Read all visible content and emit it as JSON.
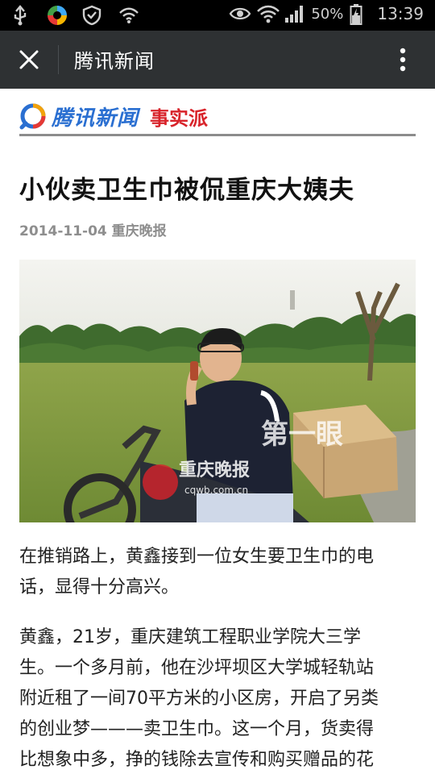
{
  "statusbar": {
    "battery_percent": "50%",
    "time": "13:39",
    "icons": [
      "usb-icon",
      "colorful-app-icon",
      "shield-icon",
      "wifi-hotspot-icon",
      "eye-icon",
      "wifi-icon",
      "signal-icon",
      "battery-icon"
    ]
  },
  "topbar": {
    "title": "腾讯新闻",
    "close_icon": "close-icon",
    "more_icon": "more-vertical-icon"
  },
  "article": {
    "brand_name": "腾讯新闻",
    "brand_column": "事实派",
    "headline": "小伙卖卫生巾被侃重庆大姨夫",
    "date": "2014-11-04",
    "source": "重庆晚报",
    "photo_watermark": "重庆晚报",
    "photo_watermark_url": "cqwb.com.cn",
    "photo_watermark_tag": "第一眼",
    "paragraphs": [
      [
        "在推销路上，黄鑫接到一位女生要卫生巾的电",
        "话，显得十分高兴。"
      ],
      [
        "黄鑫，21岁，重庆建筑工程职业学院大三学",
        "生。一个多月前，他在沙坪坝区大学城轻轨站",
        "附近租了一间70平方米的小区房，开启了另类",
        "的创业梦———卖卫生巾。这一个月，货卖得",
        "比想象中多，挣的钱除去宣传和购买赠品的花"
      ]
    ]
  },
  "colors": {
    "statusbar_bg": "#000000",
    "topbar_bg": "#2e3133",
    "brand_blue": "#2a6fd1",
    "brand_red": "#d8232a",
    "meta_gray": "#8e8e8e"
  }
}
